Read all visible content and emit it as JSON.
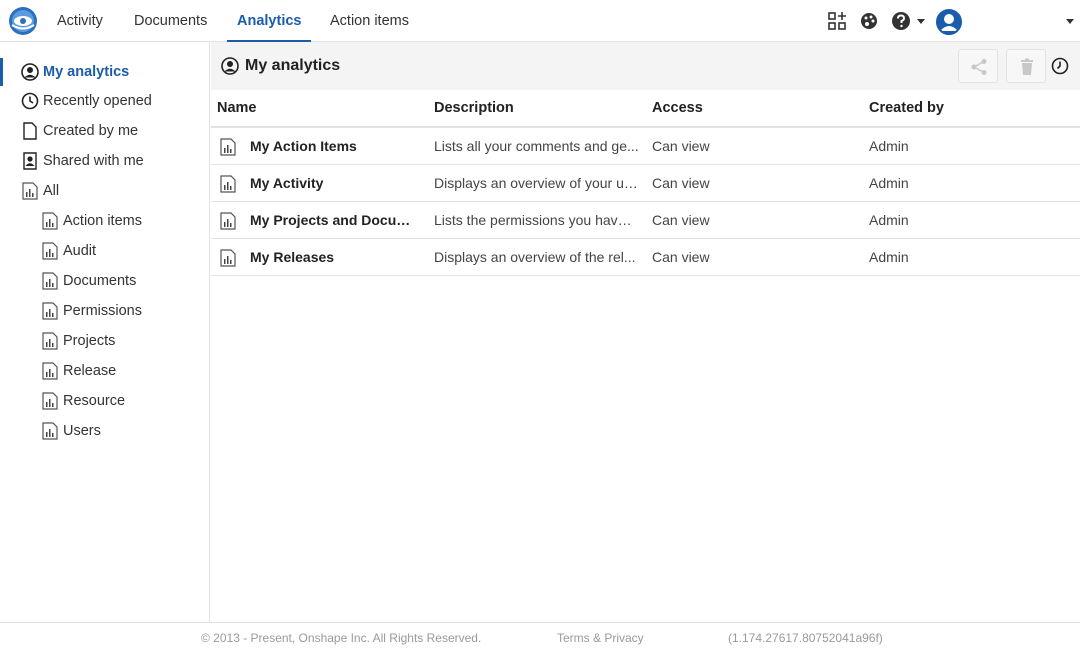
{
  "app": {
    "logo_icon": "onshape-logo-icon",
    "accent_color": "#1b5cab"
  },
  "topnav": {
    "tabs": [
      {
        "label": "Activity",
        "active": false
      },
      {
        "label": "Documents",
        "active": false
      },
      {
        "label": "Analytics",
        "active": true
      },
      {
        "label": "Action items",
        "active": false
      }
    ],
    "icons": [
      "app-store-icon",
      "appearance-palette-icon",
      "help-icon",
      "user-avatar-icon"
    ]
  },
  "sidebar": {
    "items": [
      {
        "label": "My analytics",
        "icon": "user-circle-icon",
        "active": true
      },
      {
        "label": "Recently opened",
        "icon": "clock-icon",
        "active": false
      },
      {
        "label": "Created by me",
        "icon": "document-icon",
        "active": false
      },
      {
        "label": "Shared with me",
        "icon": "shared-user-icon",
        "active": false
      },
      {
        "label": "All",
        "icon": "report-icon",
        "active": false
      }
    ],
    "sub_items": [
      {
        "label": "Action items",
        "icon": "report-icon"
      },
      {
        "label": "Audit",
        "icon": "report-icon"
      },
      {
        "label": "Documents",
        "icon": "report-icon"
      },
      {
        "label": "Permissions",
        "icon": "report-icon"
      },
      {
        "label": "Projects",
        "icon": "report-icon"
      },
      {
        "label": "Release",
        "icon": "report-icon"
      },
      {
        "label": "Resource",
        "icon": "report-icon"
      },
      {
        "label": "Users",
        "icon": "report-icon"
      }
    ]
  },
  "main": {
    "title": "My analytics",
    "title_icon": "user-circle-icon",
    "toolbar_icons": [
      "share-icon",
      "trash-icon",
      "history-icon"
    ],
    "columns": [
      "Name",
      "Description",
      "Access",
      "Created by"
    ],
    "rows": [
      {
        "name": "My Action Items",
        "description": "Lists all your comments and ge...",
        "access": "Can view",
        "created_by": "Admin"
      },
      {
        "name": "My Activity",
        "description": "Displays an overview of your us...",
        "access": "Can view",
        "created_by": "Admin"
      },
      {
        "name": "My Projects and Docum...",
        "description": "Lists the permissions you have ...",
        "access": "Can view",
        "created_by": "Admin"
      },
      {
        "name": "My Releases",
        "description": "Displays an overview of the rel...",
        "access": "Can view",
        "created_by": "Admin"
      }
    ]
  },
  "footer": {
    "copyright": "© 2013 - Present, Onshape Inc. All Rights Reserved.",
    "terms": "Terms & Privacy",
    "version": "(1.174.27617.80752041a96f)"
  }
}
